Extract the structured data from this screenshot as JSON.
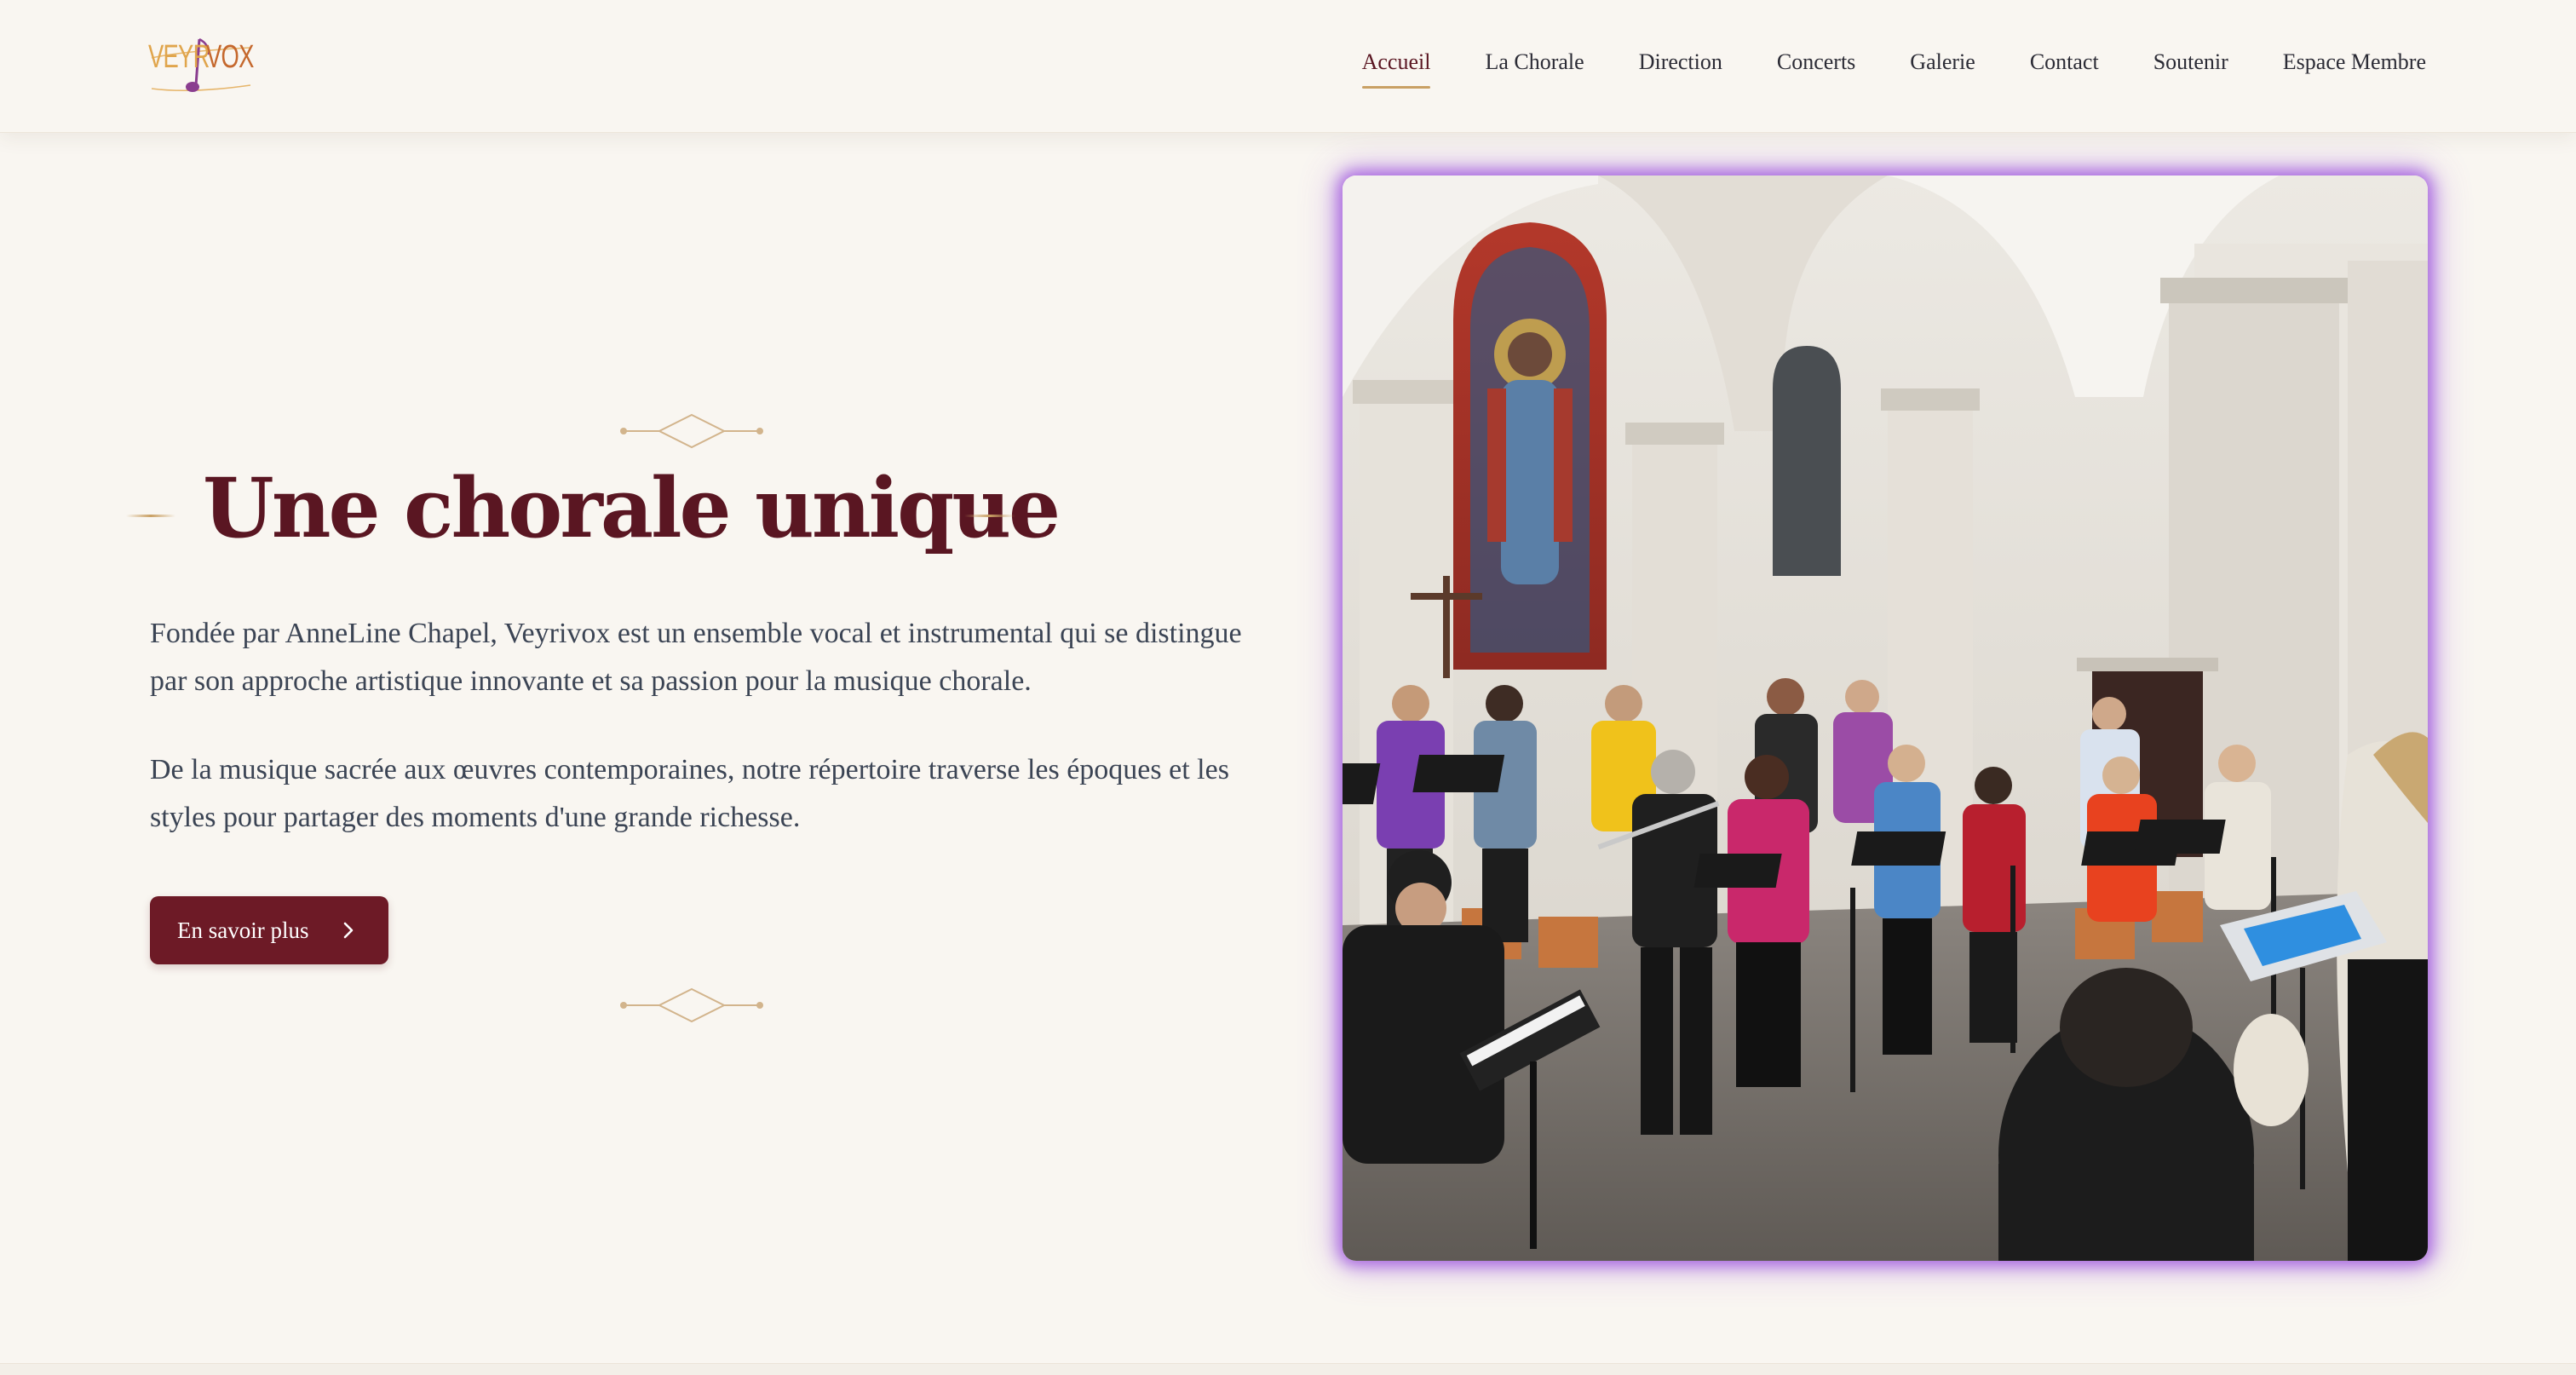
{
  "brand": {
    "logo_part1": "VEYR",
    "logo_part2": "VOX",
    "logo_icon": "music-note-icon",
    "colors": {
      "primary": "#6d1a26",
      "title": "#5a1622",
      "accent_gold": "#c9a064",
      "logo_orange": "#e0a54c",
      "logo_purple": "#8a3d8f"
    }
  },
  "nav": {
    "items": [
      {
        "label": "Accueil",
        "active": true
      },
      {
        "label": "La Chorale",
        "active": false
      },
      {
        "label": "Direction",
        "active": false
      },
      {
        "label": "Concerts",
        "active": false
      },
      {
        "label": "Galerie",
        "active": false
      },
      {
        "label": "Contact",
        "active": false
      },
      {
        "label": "Soutenir",
        "active": false
      },
      {
        "label": "Espace Membre",
        "active": false
      }
    ]
  },
  "hero": {
    "title": "Une chorale unique",
    "paragraph1": "Fondée par AnneLine Chapel, Veyrivox est un ensemble vocal et instrumental qui se distingue par son approche artistique innovante et sa passion pour la musique chorale.",
    "paragraph2": "De la musique sacrée aux œuvres contemporaines, notre répertoire traverse les époques et les styles pour partager des moments d'une grande richesse.",
    "cta_label": "En savoir plus",
    "cta_icon": "chevron-right-icon",
    "image_subject": "choir-performing-in-chapel"
  }
}
